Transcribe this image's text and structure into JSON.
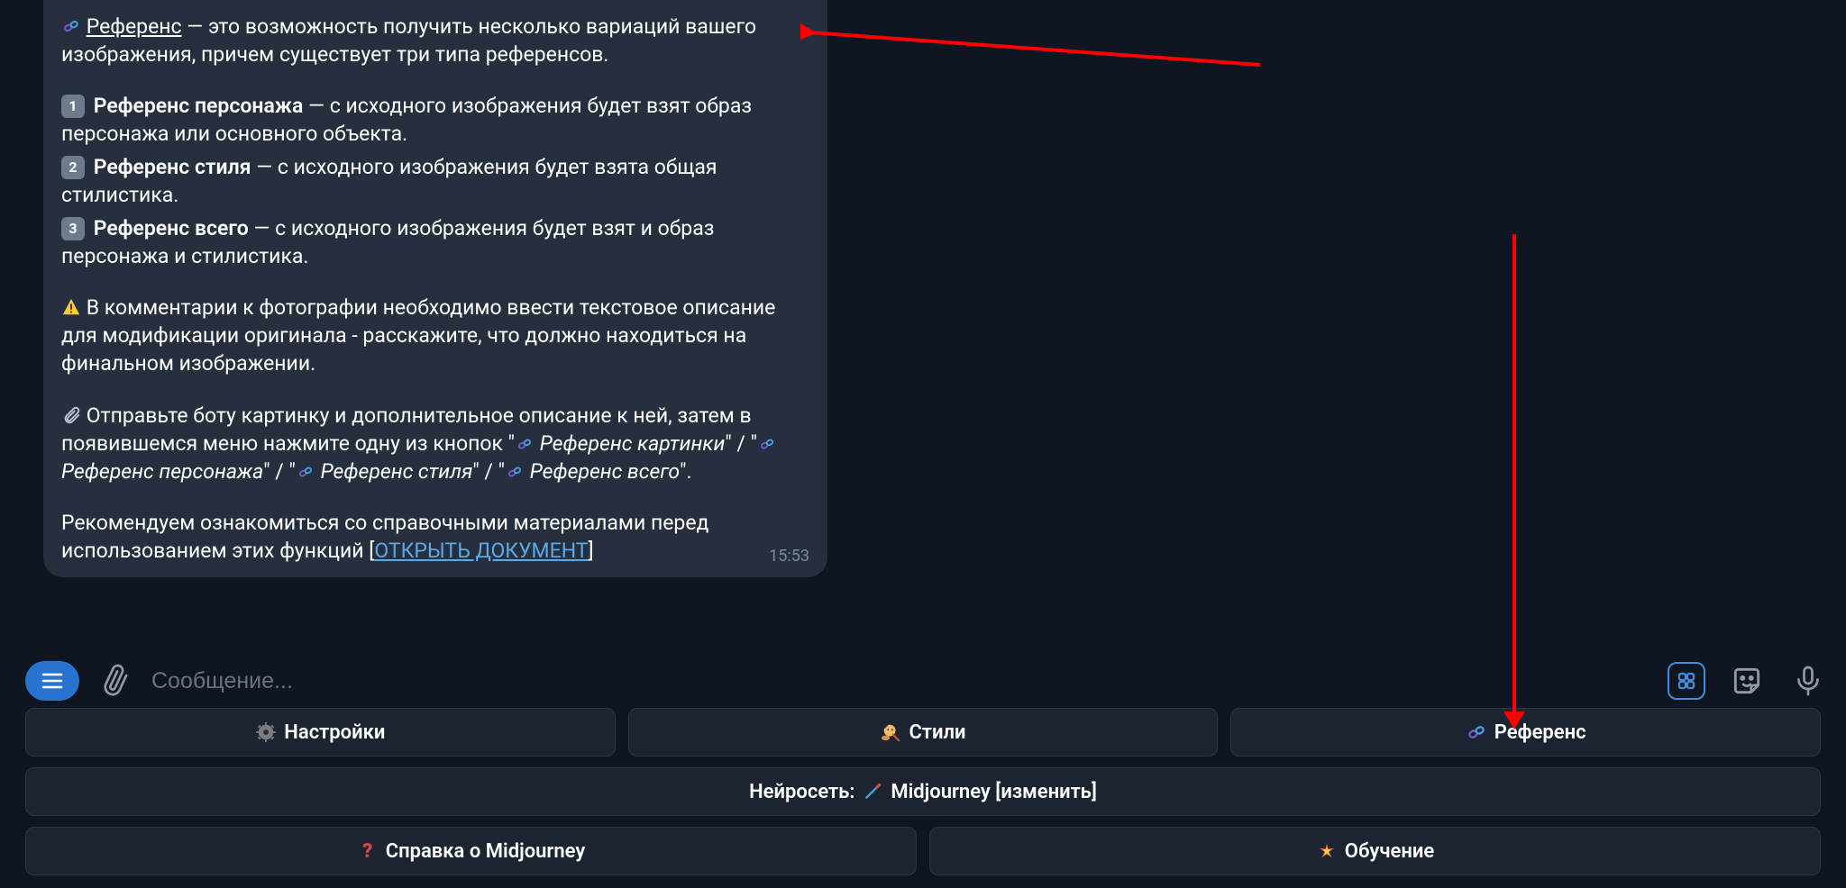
{
  "message": {
    "intro_head": "Референс",
    "intro_rest": " — это возможность получить несколько вариаций вашего изображения, причем существует три типа референсов.",
    "item1_title": "Референс персонажа",
    "item1_rest": " — с исходного изображения будет взят образ персонажа или основного объекта.",
    "item2_title": "Референс стиля",
    "item2_rest": " — с исходного изображения будет взята общая стилистика.",
    "item3_title": "Референс всего",
    "item3_rest": " — с исходного изображения будет взят и образ персонажа и стилистика.",
    "warn": "В комментарии к фотографии необходимо ввести текстовое описание для модификации оригинала - расскажите, что должно находиться на финальном изображении.",
    "instr_pre": "Отправьте боту картинку и дополнительное описание к ней, затем в появившемся меню нажмите одну из кнопок \"",
    "instr_opt1": "Референс картинки",
    "instr_sep12": "\" / \"",
    "instr_opt2": "Референс персонажа",
    "instr_sep23": "\" / \"",
    "instr_opt3": "Референс стиля",
    "instr_sep34": "\" / \"",
    "instr_opt4": "Референс всего",
    "instr_post": "\".",
    "recommend": "Рекомендуем ознакомиться со справочными материалами перед использованием этих функций [",
    "link_text": "ОТКРЫТЬ ДОКУМЕНТ",
    "recommend_close": "]",
    "timestamp": "15:53"
  },
  "input": {
    "placeholder": "Сообщение..."
  },
  "kb": {
    "row1": {
      "settings": "Настройки",
      "styles": "Стили",
      "reference": "Референс"
    },
    "row2": {
      "network_label": "Нейросеть: ",
      "network_value": "Midjourney [изменить]"
    },
    "row3": {
      "help": "Справка о Midjourney",
      "learn": "Обучение"
    }
  }
}
